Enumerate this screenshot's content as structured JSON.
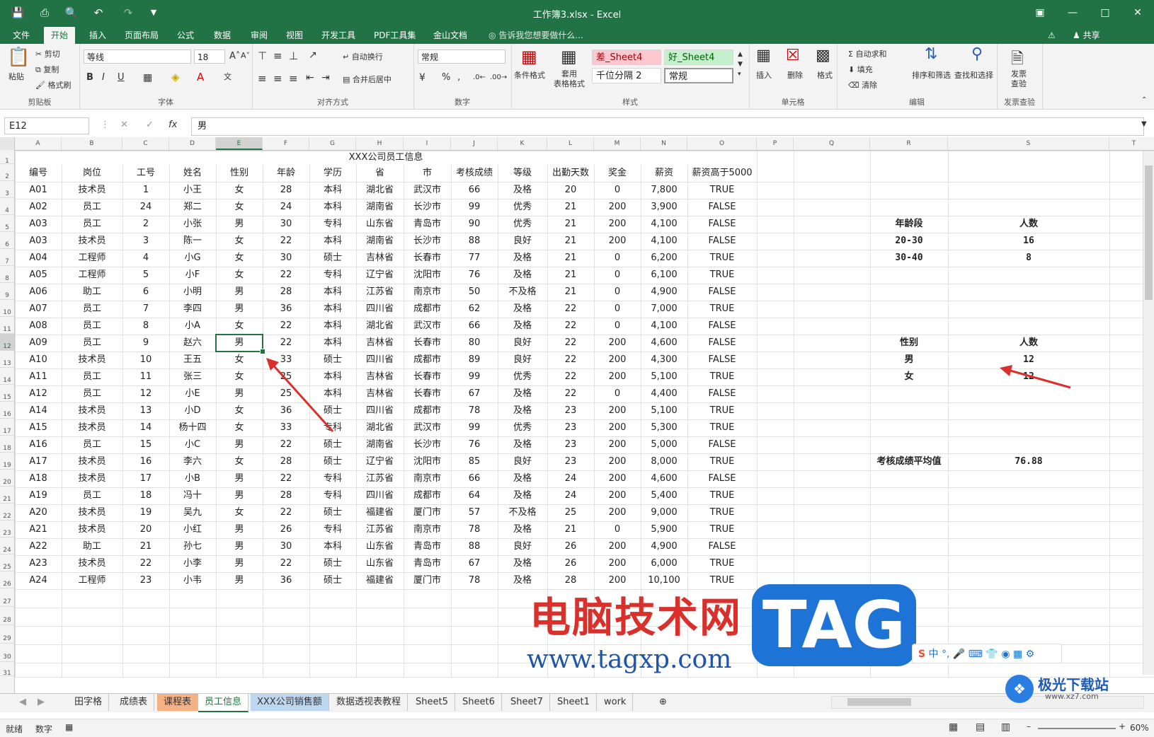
{
  "window": {
    "title": "工作簿3.xlsx - Excel",
    "share": "共享"
  },
  "ribbon_tabs": [
    "文件",
    "开始",
    "插入",
    "页面布局",
    "公式",
    "数据",
    "审阅",
    "视图",
    "开发工具",
    "PDF工具集",
    "金山文档"
  ],
  "active_tab": "开始",
  "tell_me": "告诉我您想要做什么...",
  "ribbon": {
    "clipboard": {
      "paste": "粘贴",
      "cut": "剪切",
      "copy": "复制",
      "format_painter": "格式刷",
      "label": "剪贴板"
    },
    "font": {
      "name": "等线",
      "size": "18",
      "label": "字体",
      "bold": "B",
      "italic": "I",
      "underline": "U"
    },
    "alignment": {
      "wrap": "自动换行",
      "merge": "合并后居中",
      "label": "对齐方式"
    },
    "number": {
      "format": "常规",
      "label": "数字",
      "percent": "%"
    },
    "styles": {
      "cond": "条件格式",
      "table": "套用\n表格格式",
      "bad": "差_Sheet4",
      "good": "好_Sheet4",
      "comma": "千位分隔 2",
      "normal": "常规",
      "label": "样式"
    },
    "cells": {
      "insert": "插入",
      "delete": "删除",
      "format": "格式",
      "label": "单元格"
    },
    "editing": {
      "autosum": "自动求和",
      "fill": "填充",
      "clear": "清除",
      "sort": "排序和筛选",
      "find": "查找和选择",
      "label": "编辑"
    },
    "invoice": {
      "check": "发票\n查验",
      "label": "发票查验"
    }
  },
  "formula_bar": {
    "name_box": "E12",
    "fx": "fx",
    "content": "男"
  },
  "columns": [
    "A",
    "B",
    "C",
    "D",
    "E",
    "F",
    "G",
    "H",
    "I",
    "J",
    "K",
    "L",
    "M",
    "N",
    "O",
    "P",
    "Q",
    "R",
    "S",
    "T"
  ],
  "rows": [
    "1",
    "2",
    "3",
    "4",
    "5",
    "6",
    "7",
    "8",
    "9",
    "10",
    "11",
    "12",
    "13",
    "14",
    "15",
    "16",
    "17",
    "18",
    "19",
    "20",
    "21",
    "22",
    "23",
    "24",
    "25",
    "26",
    "27",
    "28",
    "29",
    "30",
    "31"
  ],
  "table": {
    "title": "XXX公司员工信息",
    "headers": [
      "编号",
      "岗位",
      "工号",
      "姓名",
      "性别",
      "年龄",
      "学历",
      "省",
      "市",
      "考核成绩",
      "等级",
      "出勤天数",
      "奖金",
      "薪资",
      "薪资高于5000"
    ],
    "rows": [
      [
        "A01",
        "技术员",
        "1",
        "小王",
        "女",
        "28",
        "本科",
        "湖北省",
        "武汉市",
        "66",
        "及格",
        "20",
        "0",
        "7,800",
        "TRUE"
      ],
      [
        "A02",
        "员工",
        "24",
        "郑二",
        "女",
        "24",
        "本科",
        "湖南省",
        "长沙市",
        "99",
        "优秀",
        "21",
        "200",
        "3,900",
        "FALSE"
      ],
      [
        "A03",
        "员工",
        "2",
        "小张",
        "男",
        "30",
        "专科",
        "山东省",
        "青岛市",
        "90",
        "优秀",
        "21",
        "200",
        "4,100",
        "FALSE"
      ],
      [
        "A03",
        "技术员",
        "3",
        "陈一",
        "女",
        "22",
        "本科",
        "湖南省",
        "长沙市",
        "88",
        "良好",
        "21",
        "200",
        "4,100",
        "FALSE"
      ],
      [
        "A04",
        "工程师",
        "4",
        "小G",
        "女",
        "30",
        "硕士",
        "吉林省",
        "长春市",
        "77",
        "及格",
        "21",
        "0",
        "6,200",
        "TRUE"
      ],
      [
        "A05",
        "工程师",
        "5",
        "小F",
        "女",
        "22",
        "专科",
        "辽宁省",
        "沈阳市",
        "76",
        "及格",
        "21",
        "0",
        "6,100",
        "TRUE"
      ],
      [
        "A06",
        "助工",
        "6",
        "小明",
        "男",
        "28",
        "本科",
        "江苏省",
        "南京市",
        "50",
        "不及格",
        "21",
        "0",
        "4,900",
        "FALSE"
      ],
      [
        "A07",
        "员工",
        "7",
        "李四",
        "男",
        "36",
        "本科",
        "四川省",
        "成都市",
        "62",
        "及格",
        "22",
        "0",
        "7,000",
        "TRUE"
      ],
      [
        "A08",
        "员工",
        "8",
        "小A",
        "女",
        "22",
        "本科",
        "湖北省",
        "武汉市",
        "66",
        "及格",
        "22",
        "0",
        "4,100",
        "FALSE"
      ],
      [
        "A09",
        "员工",
        "9",
        "赵六",
        "男",
        "22",
        "本科",
        "吉林省",
        "长春市",
        "80",
        "良好",
        "22",
        "200",
        "4,600",
        "FALSE"
      ],
      [
        "A10",
        "技术员",
        "10",
        "王五",
        "女",
        "33",
        "硕士",
        "四川省",
        "成都市",
        "89",
        "良好",
        "22",
        "200",
        "4,300",
        "FALSE"
      ],
      [
        "A11",
        "员工",
        "11",
        "张三",
        "女",
        "25",
        "本科",
        "吉林省",
        "长春市",
        "99",
        "优秀",
        "22",
        "200",
        "5,100",
        "TRUE"
      ],
      [
        "A12",
        "员工",
        "12",
        "小E",
        "男",
        "25",
        "本科",
        "吉林省",
        "长春市",
        "67",
        "及格",
        "22",
        "0",
        "4,400",
        "FALSE"
      ],
      [
        "A14",
        "技术员",
        "13",
        "小D",
        "女",
        "36",
        "硕士",
        "四川省",
        "成都市",
        "78",
        "及格",
        "23",
        "200",
        "5,100",
        "TRUE"
      ],
      [
        "A15",
        "技术员",
        "14",
        "杨十四",
        "女",
        "33",
        "专科",
        "湖北省",
        "武汉市",
        "99",
        "优秀",
        "23",
        "200",
        "5,300",
        "TRUE"
      ],
      [
        "A16",
        "员工",
        "15",
        "小C",
        "男",
        "22",
        "硕士",
        "湖南省",
        "长沙市",
        "76",
        "及格",
        "23",
        "200",
        "5,000",
        "FALSE"
      ],
      [
        "A17",
        "技术员",
        "16",
        "李六",
        "女",
        "28",
        "硕士",
        "辽宁省",
        "沈阳市",
        "85",
        "良好",
        "23",
        "200",
        "8,000",
        "TRUE"
      ],
      [
        "A18",
        "技术员",
        "17",
        "小B",
        "男",
        "22",
        "专科",
        "江苏省",
        "南京市",
        "66",
        "及格",
        "24",
        "200",
        "4,600",
        "FALSE"
      ],
      [
        "A19",
        "员工",
        "18",
        "冯十",
        "男",
        "28",
        "专科",
        "四川省",
        "成都市",
        "64",
        "及格",
        "24",
        "200",
        "5,400",
        "TRUE"
      ],
      [
        "A20",
        "技术员",
        "19",
        "吴九",
        "女",
        "22",
        "硕士",
        "福建省",
        "厦门市",
        "57",
        "不及格",
        "25",
        "200",
        "9,000",
        "TRUE"
      ],
      [
        "A21",
        "技术员",
        "20",
        "小红",
        "男",
        "26",
        "专科",
        "江苏省",
        "南京市",
        "78",
        "及格",
        "21",
        "0",
        "5,900",
        "TRUE"
      ],
      [
        "A22",
        "助工",
        "21",
        "孙七",
        "男",
        "30",
        "本科",
        "山东省",
        "青岛市",
        "88",
        "良好",
        "26",
        "200",
        "4,900",
        "FALSE"
      ],
      [
        "A23",
        "技术员",
        "22",
        "小李",
        "男",
        "22",
        "硕士",
        "山东省",
        "青岛市",
        "67",
        "及格",
        "26",
        "200",
        "6,000",
        "TRUE"
      ],
      [
        "A24",
        "工程师",
        "23",
        "小韦",
        "男",
        "36",
        "硕士",
        "福建省",
        "厦门市",
        "78",
        "及格",
        "28",
        "200",
        "10,100",
        "TRUE"
      ]
    ]
  },
  "summary": {
    "age": {
      "h1": "年龄段",
      "h2": "人数",
      "r1": [
        "20-30",
        "16"
      ],
      "r2": [
        "30-40",
        "8"
      ]
    },
    "gender": {
      "h1": "性别",
      "h2": "人数",
      "r1": [
        "男",
        "12"
      ],
      "r2": [
        "女",
        "12"
      ]
    },
    "avg": {
      "label": "考核成绩平均值",
      "value": "76.88"
    }
  },
  "sheet_tabs": [
    "田字格",
    "成绩表",
    "课程表",
    "员工信息",
    "XXX公司销售额",
    "数据透视表教程",
    "Sheet5",
    "Sheet6",
    "Sheet7",
    "Sheet1",
    "work"
  ],
  "active_sheet": "员工信息",
  "status": {
    "ready": "就绪",
    "mode": "数字",
    "zoom": "60%"
  },
  "watermark": {
    "cn": "电脑技术网",
    "tag": "TAG",
    "url": "www.tagxp.com",
    "brand": "极光下载站",
    "brand_url": "www.xz7.com",
    "ime": "中"
  },
  "colors": {
    "excel_green": "#217346",
    "arrow_red": "#d9302c",
    "tab_orange": "#f4b183",
    "tab_blue": "#bdd7ee"
  }
}
